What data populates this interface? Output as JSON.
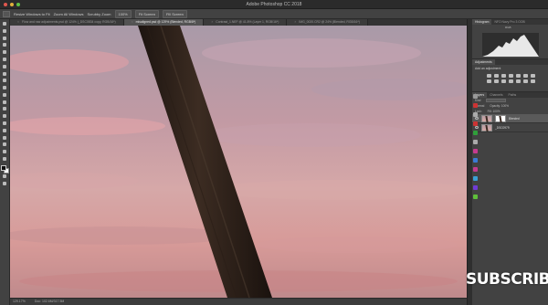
{
  "app": {
    "title": "Adobe Photoshop CC 2018"
  },
  "options_bar": {
    "checkbox_label": "Resize Windows to Fit",
    "zoom_all_label": "Zoom All Windows",
    "scrubby_label": "Scrubby Zoom",
    "btn_100": "100%",
    "btn_fit": "Fit Screen",
    "btn_fill": "Fill Screen"
  },
  "tabs": [
    {
      "label": "Flow and raw adjustments.psd @ 124% (_DSC0834 copy, RGB/16*)",
      "active": false
    },
    {
      "label": "misaligned.psd @ 129% (Blended, RGB/8*)",
      "active": true
    },
    {
      "label": "Contrast_1.NEF @ 41.8% (Layer 1, RGB/16*)",
      "active": false
    },
    {
      "label": "IMG_0020.CR2 @ 24% (Blended, RGB/16*)",
      "active": false
    }
  ],
  "status_bar": {
    "zoom": "129.17%",
    "doc": "Doc: 102.6M/317.5M"
  },
  "histogram": {
    "label": "Histogram",
    "channel": "RGB"
  },
  "panels": {
    "top_tabs": [
      "Histogram",
      "NFO Navy Pro 3 OOB"
    ],
    "adjust_tabs": [
      "Adjustments"
    ],
    "adjust_label": "Add an adjustment",
    "layer_tabs": [
      "Layers",
      "Channels",
      "Paths"
    ],
    "kind_label": "Kind",
    "blend_mode": "Normal",
    "opacity_label": "Opacity: 100%",
    "lock_label": "Lock:",
    "fill_label": "Fill: 100%"
  },
  "layers": [
    {
      "name": "Blended",
      "selected": true,
      "has_mask": true
    },
    {
      "name": "_DSC0979",
      "selected": false,
      "has_mask": false
    }
  ],
  "overlay": {
    "subscribe": "SUBSCRIBE"
  },
  "icons": [
    "move-tool-icon",
    "marquee-tool-icon",
    "lasso-tool-icon",
    "quick-select-icon",
    "crop-tool-icon",
    "eyedropper-icon",
    "healing-brush-icon",
    "brush-tool-icon",
    "clone-stamp-icon",
    "history-brush-icon",
    "eraser-icon",
    "gradient-icon",
    "blur-icon",
    "dodge-icon",
    "pen-tool-icon",
    "type-tool-icon",
    "path-select-icon",
    "rectangle-tool-icon",
    "hand-tool-icon",
    "zoom-tool-icon"
  ],
  "colors": {
    "accent": "#5a5a5a",
    "sky_pink": "#d99aa1",
    "pole": "#2d2118"
  }
}
